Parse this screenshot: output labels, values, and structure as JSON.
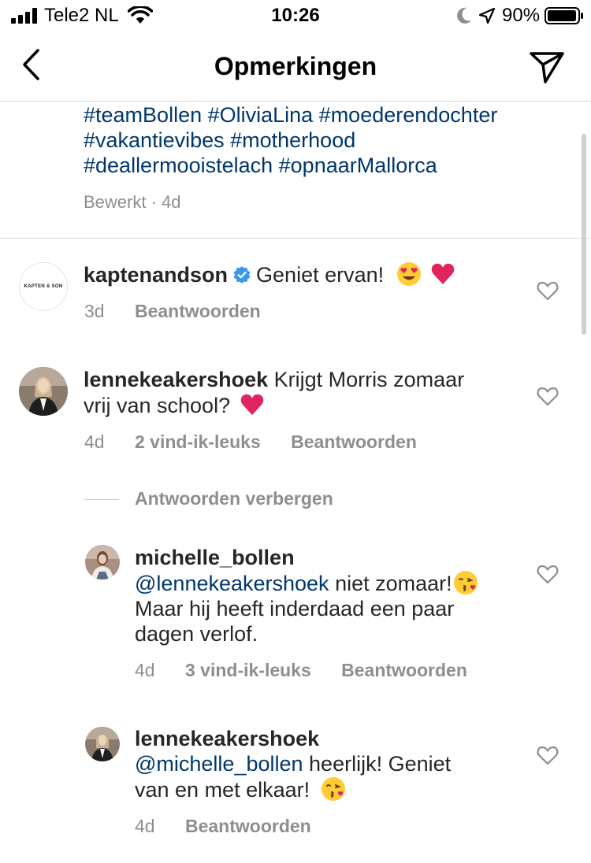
{
  "status_bar": {
    "carrier": "Tele2 NL",
    "time": "10:26",
    "battery": "90%",
    "icons": [
      "signal-icon",
      "wifi-icon",
      "moon-icon",
      "location-arrow-icon",
      "battery-icon"
    ]
  },
  "header": {
    "title": "Opmerkingen",
    "back_icon": "chevron-left-icon",
    "send_icon": "paper-plane-icon"
  },
  "caption": {
    "lines": [
      "#teamBollen #OliviaLina #moederendochter",
      "#vakantievibes #motherhood",
      "#deallermooistelach #opnaarMallorca"
    ],
    "meta": "Bewerkt · 4d"
  },
  "comments": [
    {
      "username": "kaptenandson",
      "verified": true,
      "text": "Geniet ervan!",
      "emojis": [
        "heart-eyes-emoji",
        "red-heart-emoji"
      ],
      "time": "3d",
      "reply_label": "Beantwoorden",
      "avatar_text": "KAPTEN & SON"
    },
    {
      "username": "lennekeakershoek",
      "text_line1": "Krijgt Morris zomaar",
      "text_line2": "vrij van school?",
      "emojis": [
        "red-heart-emoji"
      ],
      "time": "4d",
      "likes": "2 vind-ik-leuks",
      "reply_label": "Beantwoorden",
      "hide_replies": "Antwoorden verbergen"
    }
  ],
  "replies": [
    {
      "username": "michelle_bollen",
      "mention": "@lennekeakershoek",
      "text_line1": " niet zomaar!",
      "text_line2": "Maar hij heeft inderdaad een paar",
      "text_line3": "dagen verlof.",
      "emojis": [
        "kissing-face-emoji"
      ],
      "time": "4d",
      "likes": "3 vind-ik-leuks",
      "reply_label": "Beantwoorden"
    },
    {
      "username": "lennekeakershoek",
      "mention": "@michelle_bollen",
      "text_line1": " heerlijk! Geniet",
      "text_line2": "van en met elkaar!",
      "emojis": [
        "kissing-face-emoji"
      ],
      "time": "4d",
      "reply_label": "Beantwoorden"
    }
  ],
  "colors": {
    "link": "#00376b",
    "secondary_text": "#8e8e8e",
    "verified": "#3897f0",
    "heart_emoji": "#e0245e"
  }
}
